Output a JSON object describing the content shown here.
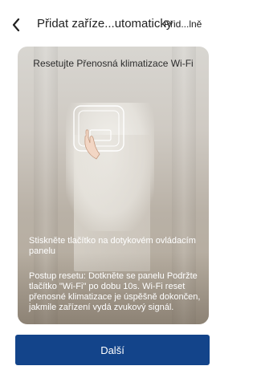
{
  "header": {
    "back_icon": "chevron-left-icon",
    "title": "Přidat zaříze...utomaticky",
    "action_label": "Přid...lně"
  },
  "card": {
    "title": "Resetujte Přenosná klimatizace Wi-Fi",
    "illustration_icon": "touch-panel-hand-icon",
    "hint": "Stiskněte tlačítko na dotykovém ovládacím panelu",
    "instructions": "Postup resetu: Dotkněte se panelu Podržte tlačítko \"Wi-Fi\" po dobu 10s. Wi-Fi reset přenosné klimatizace je úspěšně dokončen, jakmile zařízení vydá zvukový signál."
  },
  "footer": {
    "next_label": "Další"
  },
  "colors": {
    "primary": "#13448a",
    "text": "#222222",
    "overlay_text": "#ffffff"
  }
}
